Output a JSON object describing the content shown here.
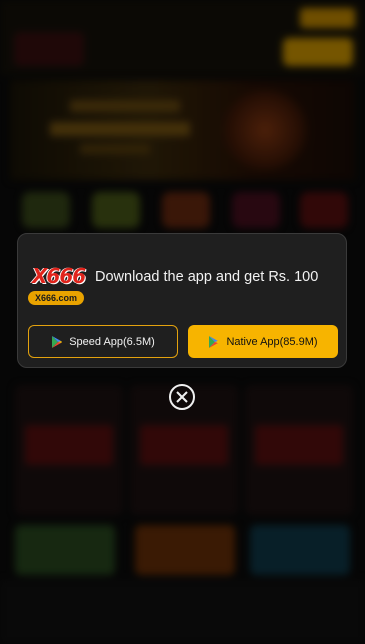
{
  "modal": {
    "brand_name": "X666",
    "brand_domain": "X666.com",
    "promo_text": "Download the app and get Rs. 100",
    "speed_app_label": "Speed App(6.5M)",
    "native_app_label": "Native App(85.9M)"
  },
  "icons": {
    "play_store": "google-play-icon",
    "close": "close-icon"
  },
  "colors": {
    "accent": "#f7b400",
    "speed_border": "#e3a20e",
    "modal_bg": "#1f1f1f",
    "brand_red": "#e0241c"
  }
}
